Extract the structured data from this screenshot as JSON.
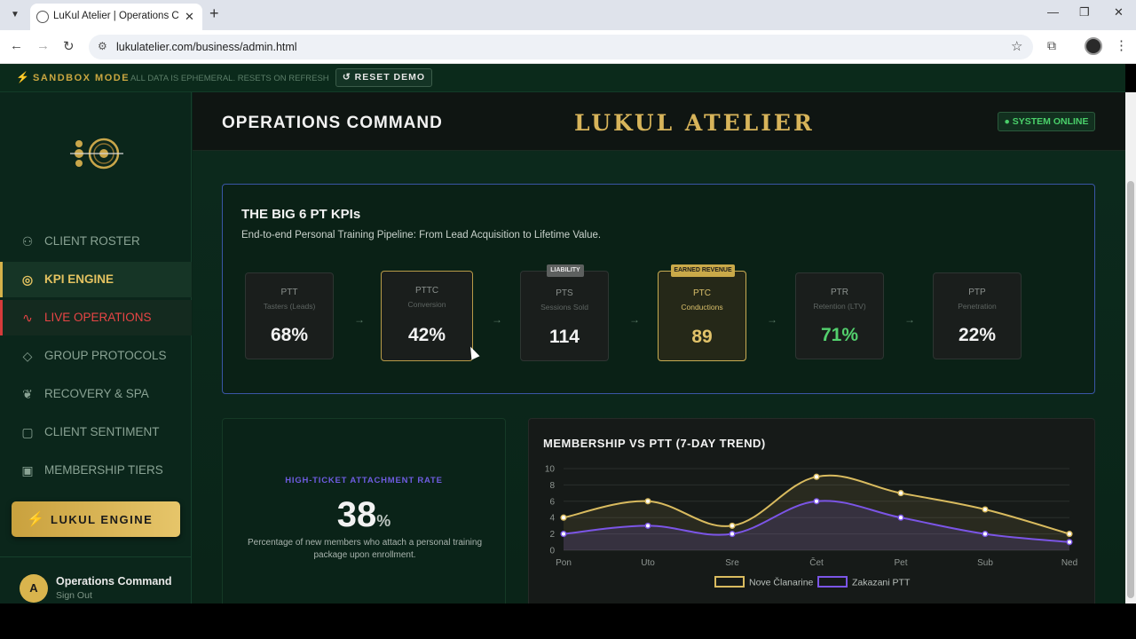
{
  "browser": {
    "tab_title": "LuKul Atelier | Operations Command",
    "url": "lukulatelier.com/business/admin.html"
  },
  "sandbox": {
    "title": "SANDBOX MODE",
    "note": "ALL DATA IS EPHEMERAL. RESETS ON REFRESH",
    "reset_label": "↺ RESET DEMO"
  },
  "sidebar": {
    "items": [
      {
        "label": "CLIENT ROSTER",
        "icon": "users-icon"
      },
      {
        "label": "KPI ENGINE",
        "icon": "target-icon"
      },
      {
        "label": "LIVE OPERATIONS",
        "icon": "pulse-icon"
      },
      {
        "label": "GROUP PROTOCOLS",
        "icon": "layers-icon"
      },
      {
        "label": "RECOVERY & SPA",
        "icon": "leaf-icon"
      },
      {
        "label": "CLIENT SENTIMENT",
        "icon": "message-icon"
      },
      {
        "label": "MEMBERSHIP TIERS",
        "icon": "briefcase-icon"
      }
    ],
    "engine_label": "LUKUL ENGINE",
    "user": {
      "initial": "A",
      "name": "Operations Command",
      "signout": "Sign Out"
    }
  },
  "header": {
    "title": "OPERATIONS COMMAND",
    "brand": "LUKUL ATELIER",
    "status": "● SYSTEM ONLINE"
  },
  "kpi": {
    "title": "THE BIG 6 PT KPIs",
    "subtitle": "End-to-end Personal Training Pipeline: From Lead Acquisition to Lifetime Value.",
    "cards": [
      {
        "code": "PTT",
        "desc": "Tasters (Leads)",
        "value": "68%"
      },
      {
        "code": "PTTC",
        "desc": "Conversion",
        "value": "42%"
      },
      {
        "code": "PTS",
        "desc": "Sessions Sold",
        "value": "114",
        "badge": "LIABILITY"
      },
      {
        "code": "PTC",
        "desc": "Conductions",
        "value": "89",
        "badge": "EARNED REVENUE"
      },
      {
        "code": "PTR",
        "desc": "Retention (LTV)",
        "value": "71%"
      },
      {
        "code": "PTP",
        "desc": "Penetration",
        "value": "22%"
      }
    ]
  },
  "attach": {
    "label": "HIGH-TICKET ATTACHMENT RATE",
    "value": "38",
    "unit": "%",
    "desc": "Percentage of new members who attach a personal training package upon enrollment."
  },
  "chart_data": {
    "type": "line",
    "title": "MEMBERSHIP VS PTT (7-DAY TREND)",
    "categories": [
      "Pon",
      "Uto",
      "Sre",
      "Čet",
      "Pet",
      "Sub",
      "Ned"
    ],
    "series": [
      {
        "name": "Nove Članarine",
        "values": [
          4,
          6,
          3,
          9,
          7,
          5,
          2
        ],
        "color": "#d9bb5f"
      },
      {
        "name": "Zakazani PTT",
        "values": [
          2,
          3,
          2,
          6,
          4,
          2,
          1
        ],
        "color": "#7b55e6"
      }
    ],
    "ylim": [
      0,
      10
    ],
    "yticks": [
      0,
      2,
      4,
      6,
      8,
      10
    ],
    "legend": "bottom"
  }
}
